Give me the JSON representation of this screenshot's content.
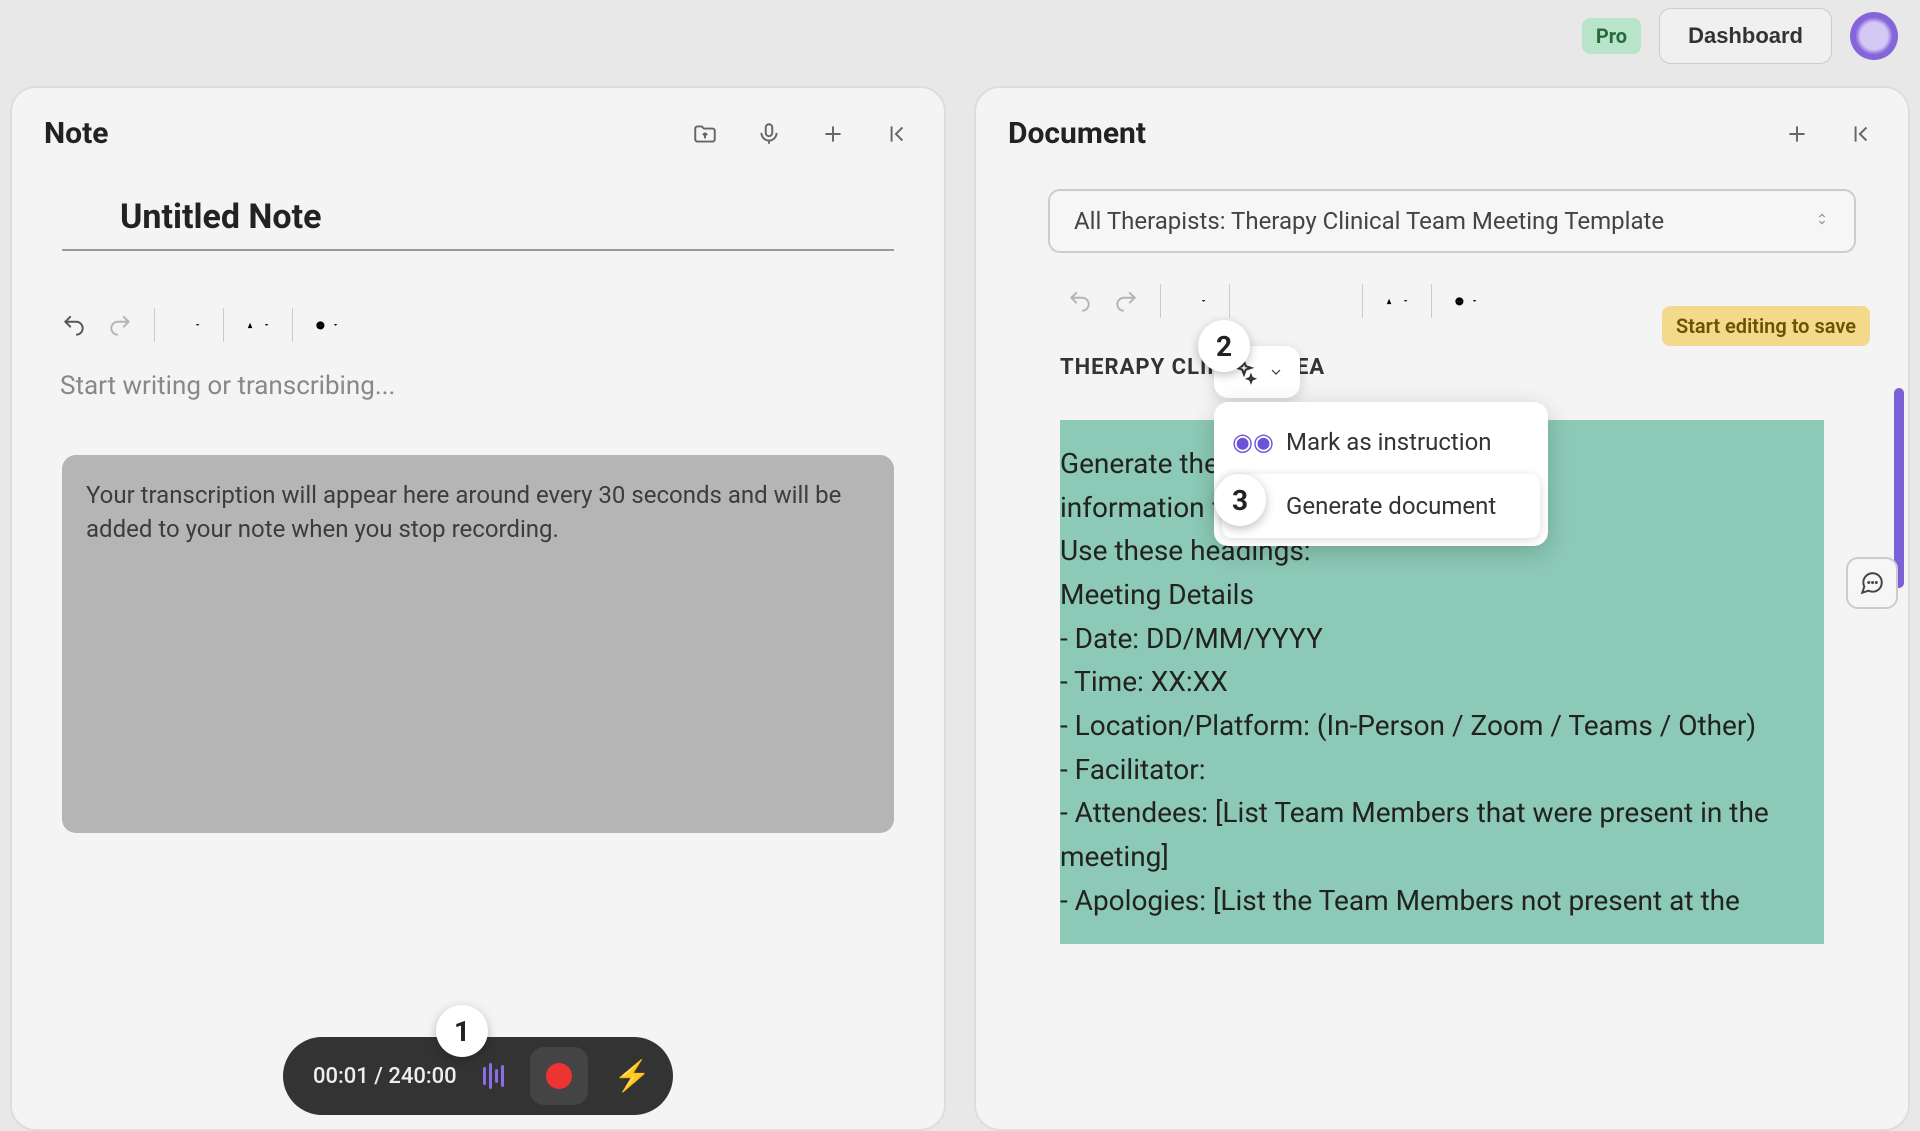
{
  "header": {
    "pro_label": "Pro",
    "dashboard_label": "Dashboard"
  },
  "note_panel": {
    "title": "Note",
    "untitled": "Untitled Note",
    "placeholder": "Start writing or transcribing...",
    "transcript_hint": "Your transcription will appear here around every 30 seconds and will be added to your note when you stop recording."
  },
  "recorder": {
    "time": "00:01 / 240:00"
  },
  "doc_panel": {
    "title": "Document",
    "template_name": "All Therapists: Therapy Clinical Team Meeting Template",
    "save_hint": "Start editing to save",
    "heading": "THERAPY CLINICAL TEA",
    "body_lines": [
      "Generate therapy                                    tes taking",
      "information from the selected note(s).",
      "Use these headings:",
      "Meeting Details",
      "- Date: DD/MM/YYYY",
      "- Time: XX:XX",
      "- Location/Platform: (In-Person / Zoom / Teams / Other)",
      "- Facilitator:",
      "- Attendees: [List Team Members that were present in the meeting]",
      "- Apologies: [List the Team Members not present at the"
    ]
  },
  "ai_menu": {
    "item1": "Mark as instruction",
    "item2": "Generate document"
  },
  "callouts": {
    "c1": "1",
    "c2": "2",
    "c3": "3"
  }
}
